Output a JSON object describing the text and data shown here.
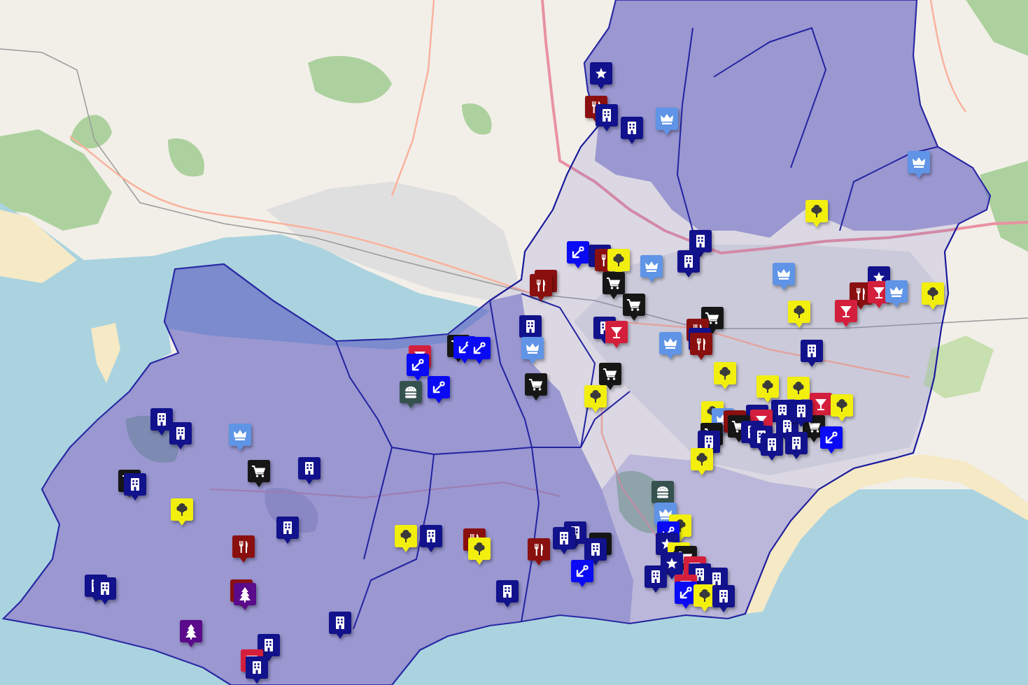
{
  "map": {
    "markers": [
      {
        "kind": "star",
        "color": "#12128c"
      },
      {
        "kind": "cutlery",
        "color": "#8a1010"
      },
      {
        "kind": "building",
        "color": "#12128c"
      },
      {
        "kind": "crown",
        "color": "#5f94e6"
      },
      {
        "kind": "building",
        "color": "#12128c"
      },
      {
        "kind": "crown",
        "color": "#5f94e6"
      },
      {
        "kind": "tree",
        "color": "#f2ef0f"
      },
      {
        "kind": "building",
        "color": "#12128c"
      },
      {
        "kind": "anchor",
        "color": "#0a0af5"
      },
      {
        "kind": "building",
        "color": "#12128c"
      },
      {
        "kind": "cutlery",
        "color": "#8a1010"
      },
      {
        "kind": "tree",
        "color": "#f2ef0f"
      },
      {
        "kind": "building",
        "color": "#12128c"
      },
      {
        "kind": "crown",
        "color": "#5f94e6"
      },
      {
        "kind": "crown",
        "color": "#5f94e6"
      },
      {
        "kind": "star",
        "color": "#12128c"
      },
      {
        "kind": "cutlery",
        "color": "#8a1010"
      },
      {
        "kind": "cutlery",
        "color": "#8a1010"
      },
      {
        "kind": "cart",
        "color": "#161616"
      },
      {
        "kind": "cutlery",
        "color": "#8a1010"
      },
      {
        "kind": "cocktail",
        "color": "#d41f3c"
      },
      {
        "kind": "crown",
        "color": "#5f94e6"
      },
      {
        "kind": "tree",
        "color": "#f2ef0f"
      },
      {
        "kind": "cart",
        "color": "#161616"
      },
      {
        "kind": "cocktail",
        "color": "#d41f3c"
      },
      {
        "kind": "tree",
        "color": "#f2ef0f"
      },
      {
        "kind": "cart",
        "color": "#161616"
      },
      {
        "kind": "building",
        "color": "#12128c"
      },
      {
        "kind": "building",
        "color": "#12128c"
      },
      {
        "kind": "cutlery",
        "color": "#8a1010"
      },
      {
        "kind": "cocktail",
        "color": "#d41f3c"
      },
      {
        "kind": "building",
        "color": "#12128c"
      },
      {
        "kind": "cutlery",
        "color": "#8a1010"
      },
      {
        "kind": "crown",
        "color": "#5f94e6"
      },
      {
        "kind": "cart",
        "color": "#161616"
      },
      {
        "kind": "anchor",
        "color": "#0a0af5"
      },
      {
        "kind": "anchor",
        "color": "#0a0af5"
      },
      {
        "kind": "crown",
        "color": "#5f94e6"
      },
      {
        "kind": "building",
        "color": "#12128c"
      },
      {
        "kind": "cocktail",
        "color": "#d41f3c"
      },
      {
        "kind": "anchor",
        "color": "#0a0af5"
      },
      {
        "kind": "tree",
        "color": "#f2ef0f"
      },
      {
        "kind": "cart",
        "color": "#161616"
      },
      {
        "kind": "cart",
        "color": "#161616"
      },
      {
        "kind": "anchor",
        "color": "#0a0af5"
      },
      {
        "kind": "tree",
        "color": "#f2ef0f"
      },
      {
        "kind": "tree",
        "color": "#f2ef0f"
      },
      {
        "kind": "burger",
        "color": "#35524f"
      },
      {
        "kind": "tree",
        "color": "#f2ef0f"
      },
      {
        "kind": "cocktail",
        "color": "#d41f3c"
      },
      {
        "kind": "tree",
        "color": "#f2ef0f"
      },
      {
        "kind": "tree",
        "color": "#f2ef0f"
      },
      {
        "kind": "building",
        "color": "#12128c"
      },
      {
        "kind": "building",
        "color": "#12128c"
      },
      {
        "kind": "crown",
        "color": "#5f94e6"
      },
      {
        "kind": "cutlery",
        "color": "#8a1010"
      },
      {
        "kind": "cocktail",
        "color": "#d41f3c"
      },
      {
        "kind": "cart",
        "color": "#161616"
      },
      {
        "kind": "building",
        "color": "#12128c"
      },
      {
        "kind": "cart",
        "color": "#161616"
      },
      {
        "kind": "building",
        "color": "#12128c"
      },
      {
        "kind": "building",
        "color": "#12128c"
      },
      {
        "kind": "cart",
        "color": "#161616"
      },
      {
        "kind": "building",
        "color": "#12128c"
      },
      {
        "kind": "building",
        "color": "#12128c"
      },
      {
        "kind": "building",
        "color": "#12128c"
      },
      {
        "kind": "building",
        "color": "#12128c"
      },
      {
        "kind": "anchor",
        "color": "#0a0af5"
      },
      {
        "kind": "building",
        "color": "#12128c"
      },
      {
        "kind": "crown",
        "color": "#5f94e6"
      },
      {
        "kind": "building",
        "color": "#12128c"
      },
      {
        "kind": "tree",
        "color": "#f2ef0f"
      },
      {
        "kind": "building",
        "color": "#12128c"
      },
      {
        "kind": "cart",
        "color": "#161616"
      },
      {
        "kind": "cart",
        "color": "#161616"
      },
      {
        "kind": "building",
        "color": "#12128c"
      },
      {
        "kind": "burger",
        "color": "#35524f"
      },
      {
        "kind": "tree",
        "color": "#f2ef0f"
      },
      {
        "kind": "crown",
        "color": "#5f94e6"
      },
      {
        "kind": "tree",
        "color": "#f2ef0f"
      },
      {
        "kind": "building",
        "color": "#12128c"
      },
      {
        "kind": "anchor",
        "color": "#0a0af5"
      },
      {
        "kind": "building",
        "color": "#12128c"
      },
      {
        "kind": "tree",
        "color": "#f2ef0f"
      },
      {
        "kind": "building",
        "color": "#12128c"
      },
      {
        "kind": "cutlery",
        "color": "#8a1010"
      },
      {
        "kind": "building",
        "color": "#12128c"
      },
      {
        "kind": "star",
        "color": "#12128c"
      },
      {
        "kind": "cart",
        "color": "#161616"
      },
      {
        "kind": "cutlery",
        "color": "#8a1010"
      },
      {
        "kind": "tree",
        "color": "#f2ef0f"
      },
      {
        "kind": "building",
        "color": "#12128c"
      },
      {
        "kind": "cutlery",
        "color": "#8a1010"
      },
      {
        "kind": "tree",
        "color": "#f2ef0f"
      },
      {
        "kind": "cart",
        "color": "#161616"
      },
      {
        "kind": "star",
        "color": "#12128c"
      },
      {
        "kind": "cocktail",
        "color": "#d41f3c"
      },
      {
        "kind": "anchor",
        "color": "#0a0af5"
      },
      {
        "kind": "building",
        "color": "#12128c"
      },
      {
        "kind": "building",
        "color": "#12128c"
      },
      {
        "kind": "building",
        "color": "#12128c"
      },
      {
        "kind": "building",
        "color": "#12128c"
      },
      {
        "kind": "building",
        "color": "#12128c"
      },
      {
        "kind": "cutlery",
        "color": "#8a1010"
      },
      {
        "kind": "pine",
        "color": "#5a0a8a"
      },
      {
        "kind": "cocktail",
        "color": "#d41f3c"
      },
      {
        "kind": "anchor",
        "color": "#0a0af5"
      },
      {
        "kind": "building",
        "color": "#12128c"
      },
      {
        "kind": "tree",
        "color": "#f2ef0f"
      },
      {
        "kind": "building",
        "color": "#12128c"
      },
      {
        "kind": "building",
        "color": "#12128c"
      },
      {
        "kind": "pine",
        "color": "#5a0a8a"
      },
      {
        "kind": "building",
        "color": "#12128c"
      },
      {
        "kind": "cocktail",
        "color": "#d41f3c"
      },
      {
        "kind": "building",
        "color": "#12128c"
      }
    ]
  }
}
